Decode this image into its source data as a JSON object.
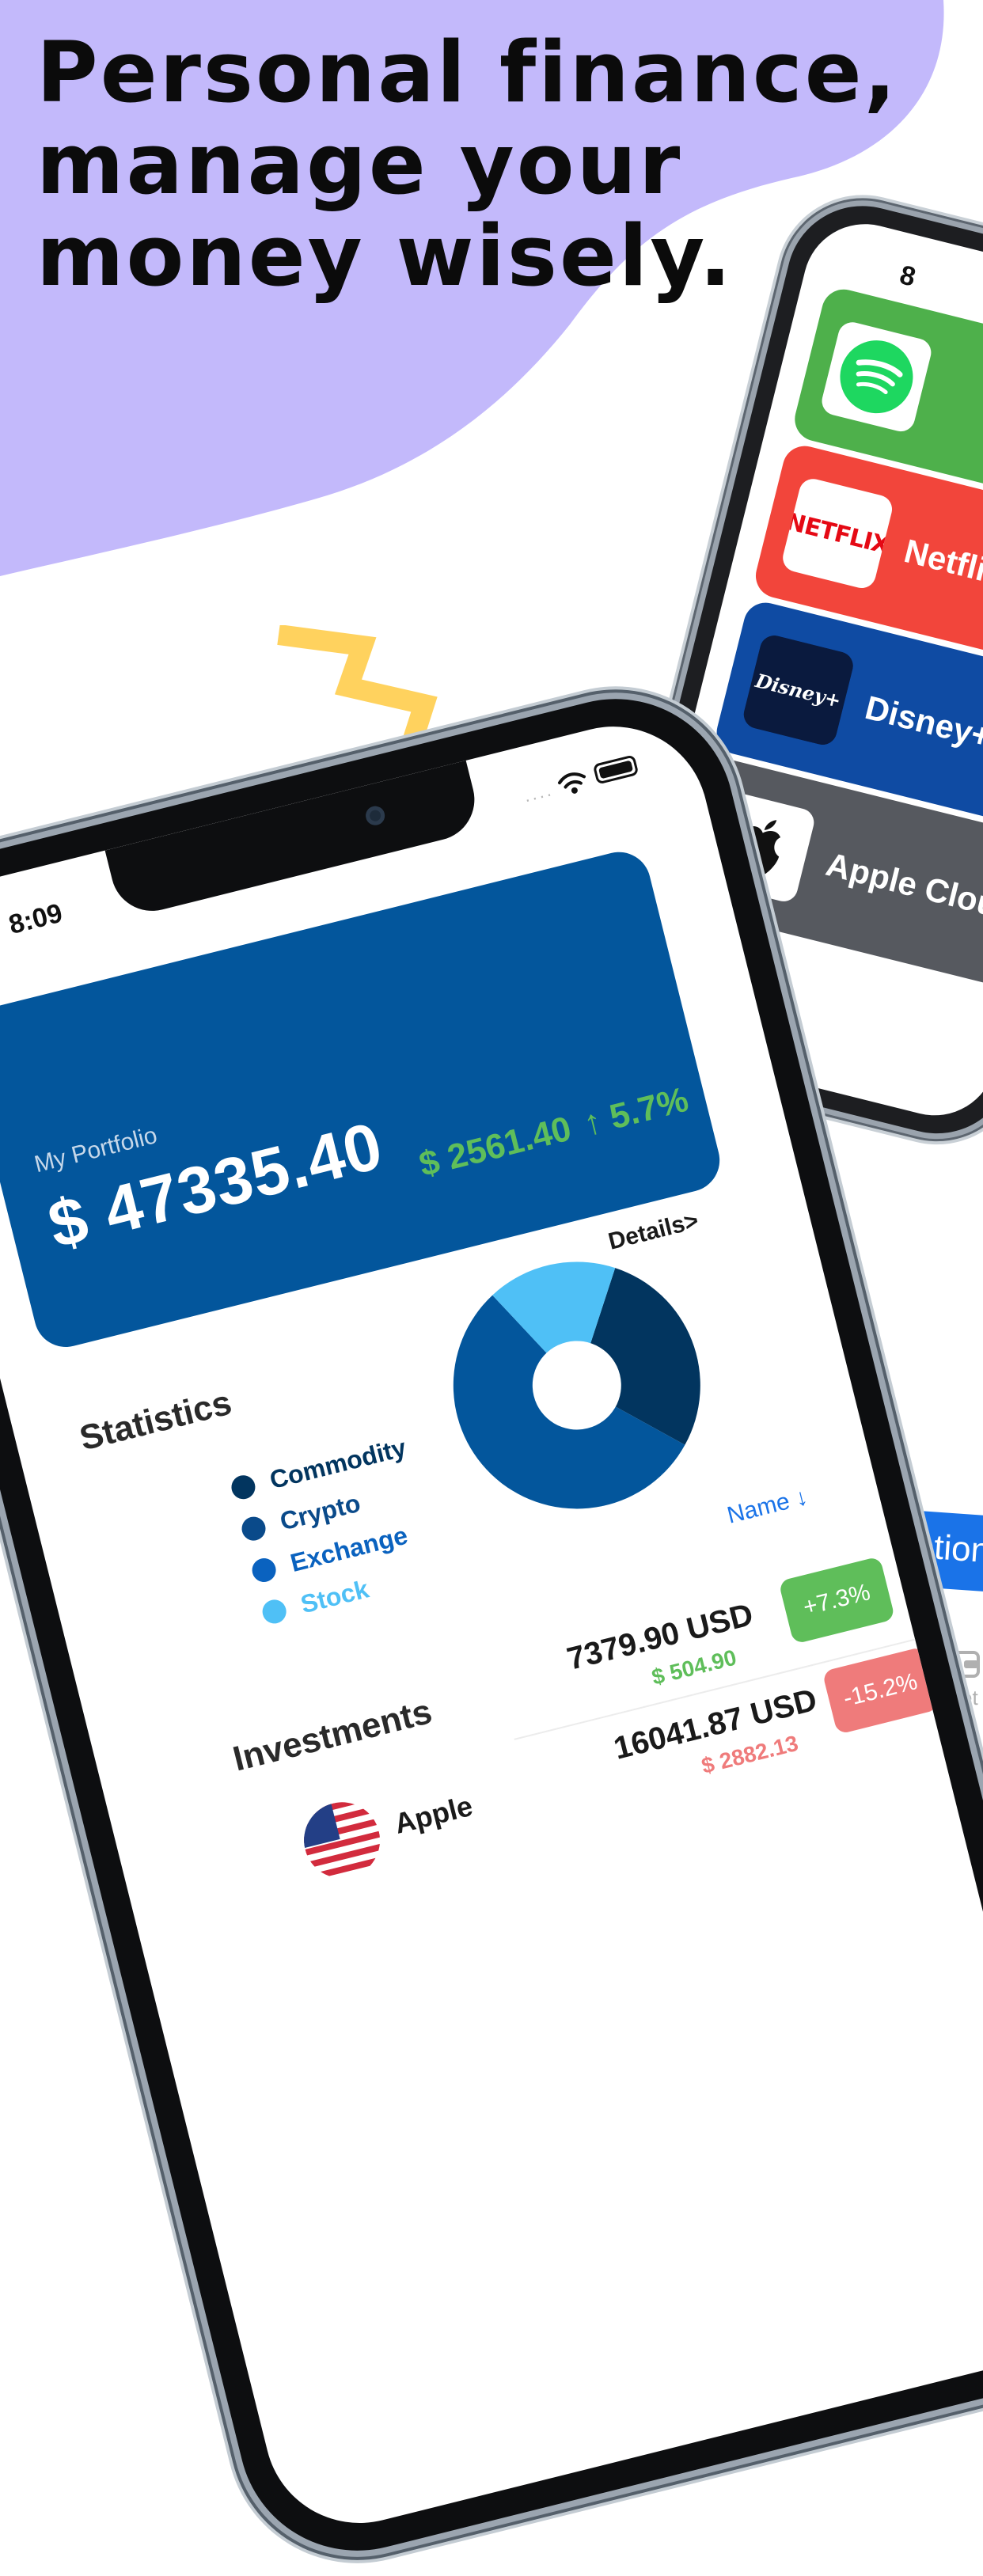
{
  "colors": {
    "blob": "#c3b9fb",
    "accent_yellow": "#ffd25e",
    "portfolio_card": "#03569c",
    "gain_green": "#5fbe5a",
    "loss_red": "#ef7b7b",
    "link_blue": "#1a73e8",
    "spotify_green": "#4eb04b",
    "netflix_red": "#f2453b",
    "disney_blue": "#0f4ba3",
    "apple_gray": "#56595f"
  },
  "headline": {
    "line1": "Personal finance,",
    "line2": "manage your",
    "line3": "money wisely."
  },
  "back_phone": {
    "time": "8",
    "subscriptions": [
      {
        "name": "",
        "icon": "spotify-icon",
        "color": "#4eb04b"
      },
      {
        "name": "Netflix",
        "icon": "netflix-logo",
        "logo_text": "NETFLIX",
        "color": "#f2453b"
      },
      {
        "name": "Disney+",
        "icon": "disney-plus-logo",
        "logo_text": "Disney+",
        "color": "#0f4ba3"
      },
      {
        "name": "Apple Cloud",
        "icon": "apple-icon",
        "color": "#56595f"
      }
    ]
  },
  "front_phone": {
    "status": {
      "time": "8:09",
      "icons": [
        "signal-dots-icon",
        "wifi-icon",
        "battery-icon"
      ]
    },
    "portfolio": {
      "label": "My Portfolio",
      "total": "$ 47335.40",
      "change_amount": "$ 2561.40",
      "change_percent": "↑ 5.7%"
    },
    "details_link": "Details>",
    "statistics": {
      "title": "Statistics",
      "legend": [
        {
          "label": "Commodity",
          "color": "#02355f"
        },
        {
          "label": "Crypto",
          "color": "#0a4a8a"
        },
        {
          "label": "Exchange",
          "color": "#0a62bf"
        },
        {
          "label": "Stock",
          "color": "#4fc0f6"
        }
      ]
    },
    "sort": {
      "label": "Name ↓"
    },
    "investments": {
      "title": "Investments",
      "rows": [
        {
          "name": "",
          "amount": "7379.90 USD",
          "gain": "$ 504.90",
          "percent": "+7.3%",
          "trend": "up"
        },
        {
          "name": "Apple",
          "amount": "16041.87 USD",
          "gain": "$ 2882.13",
          "percent": "-15.2%",
          "trend": "down",
          "flag": "us-flag-icon"
        }
      ]
    }
  },
  "chart_data": {
    "type": "pie",
    "categories": [
      "Commodity",
      "Crypto",
      "Exchange",
      "Stock"
    ],
    "values": [
      28,
      0,
      55,
      17
    ],
    "colors": [
      "#02355f",
      "#0a4a8a",
      "#03569c",
      "#4fc0f6"
    ],
    "donut": true,
    "unit": "%"
  },
  "bottom_right": {
    "tab_label": "ription",
    "wallet_label": "allet",
    "wallet_icon": "wallet-icon"
  }
}
